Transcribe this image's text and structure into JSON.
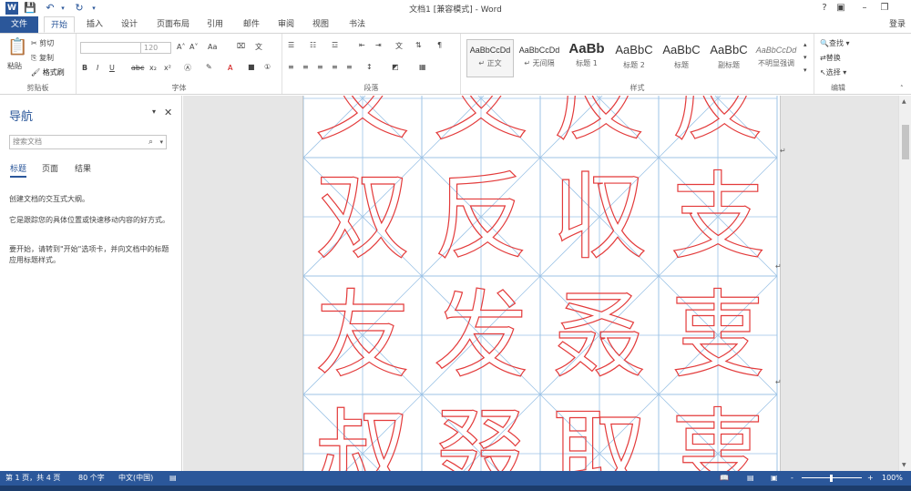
{
  "title_bar": {
    "document_title": "文档1 [兼容模式] - Word",
    "app_icon": "word-app-icon",
    "quick_access": [
      "save-icon",
      "undo-icon",
      "redo-icon",
      "customize-icon"
    ],
    "window_buttons": [
      "help",
      "ribbon-display",
      "minimize",
      "restore"
    ],
    "help_label": "?"
  },
  "tabs": {
    "file": "文件",
    "home": "开始",
    "insert": "插入",
    "design": "设计",
    "layout": "页面布局",
    "references": "引用",
    "mailings": "邮件",
    "review": "审阅",
    "view": "视图",
    "addin": "书法",
    "login": "登录"
  },
  "ribbon": {
    "clipboard": {
      "label": "剪贴板",
      "paste": "粘贴",
      "cut": "剪切",
      "copy": "复制",
      "format_painter": "格式刷"
    },
    "font": {
      "label": "字体",
      "font_name": "",
      "font_size": "120",
      "bold": "B",
      "italic": "I",
      "underline": "U",
      "strikethrough": "abc",
      "subscript": "x₂",
      "superscript": "x²",
      "grow": "A",
      "shrink": "A",
      "change_case": "Aa",
      "font_color": "A"
    },
    "paragraph": {
      "label": "段落"
    },
    "styles": {
      "label": "样式",
      "items": [
        {
          "sample": "AaBbCcDd",
          "name": "正文"
        },
        {
          "sample": "AaBbCcDd",
          "name": "无间隔"
        },
        {
          "sample": "AaBb",
          "name": "标题 1"
        },
        {
          "sample": "AaBbC",
          "name": "标题 2"
        },
        {
          "sample": "AaBbC",
          "name": "标题"
        },
        {
          "sample": "AaBbC",
          "name": "副标题"
        },
        {
          "sample": "AaBbCcDd",
          "name": "不明显强调"
        }
      ]
    },
    "editing": {
      "label": "编辑",
      "find": "查找",
      "replace": "替换",
      "select": "选择"
    }
  },
  "nav_pane": {
    "title": "导航",
    "search_placeholder": "搜索文档",
    "tabs": [
      "标题",
      "页面",
      "结果"
    ],
    "text1": "创建文档的交互式大纲。",
    "text2": "它是跟踪您的具体位置或快速移动内容的好方式。",
    "text3": "要开始，请转到\"开始\"选项卡，并向文档中的标题应用标题样式。"
  },
  "document": {
    "rows": [
      [
        "叉",
        "叉",
        "反",
        "反"
      ],
      [
        "双",
        "反",
        "収",
        "支"
      ],
      [
        "友",
        "发",
        "叒",
        "叓"
      ],
      [
        "叔",
        "叕",
        "取",
        "叓"
      ]
    ],
    "char_color": "#e33b3b",
    "grid_color": "#9cc3e6"
  },
  "status_bar": {
    "page": "第 1 页，共 4 页",
    "words": "80 个字",
    "language": "中文(中国)",
    "zoom": "100%",
    "zoom_minus": "-",
    "zoom_plus": "+"
  },
  "colors": {
    "accent": "#2b579a"
  }
}
